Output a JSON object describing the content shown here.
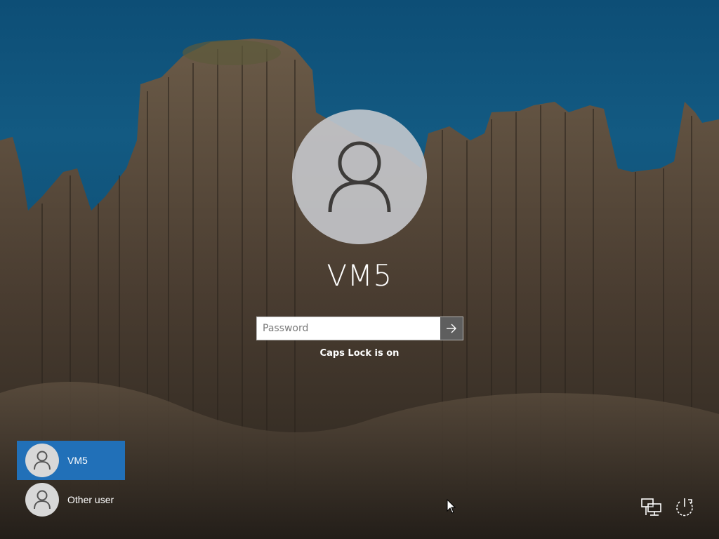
{
  "account": {
    "username": "VM5"
  },
  "password": {
    "placeholder": "Password",
    "value": ""
  },
  "status": {
    "caps_lock": "Caps Lock is on"
  },
  "user_list": [
    {
      "name": "VM5",
      "selected": true
    },
    {
      "name": "Other user",
      "selected": false
    }
  ],
  "icons": {
    "submit": "arrow-right-icon",
    "network": "network-icon",
    "power": "power-icon"
  },
  "colors": {
    "selected_user": "#2170b8",
    "submit_button": "#5e5e5e"
  }
}
